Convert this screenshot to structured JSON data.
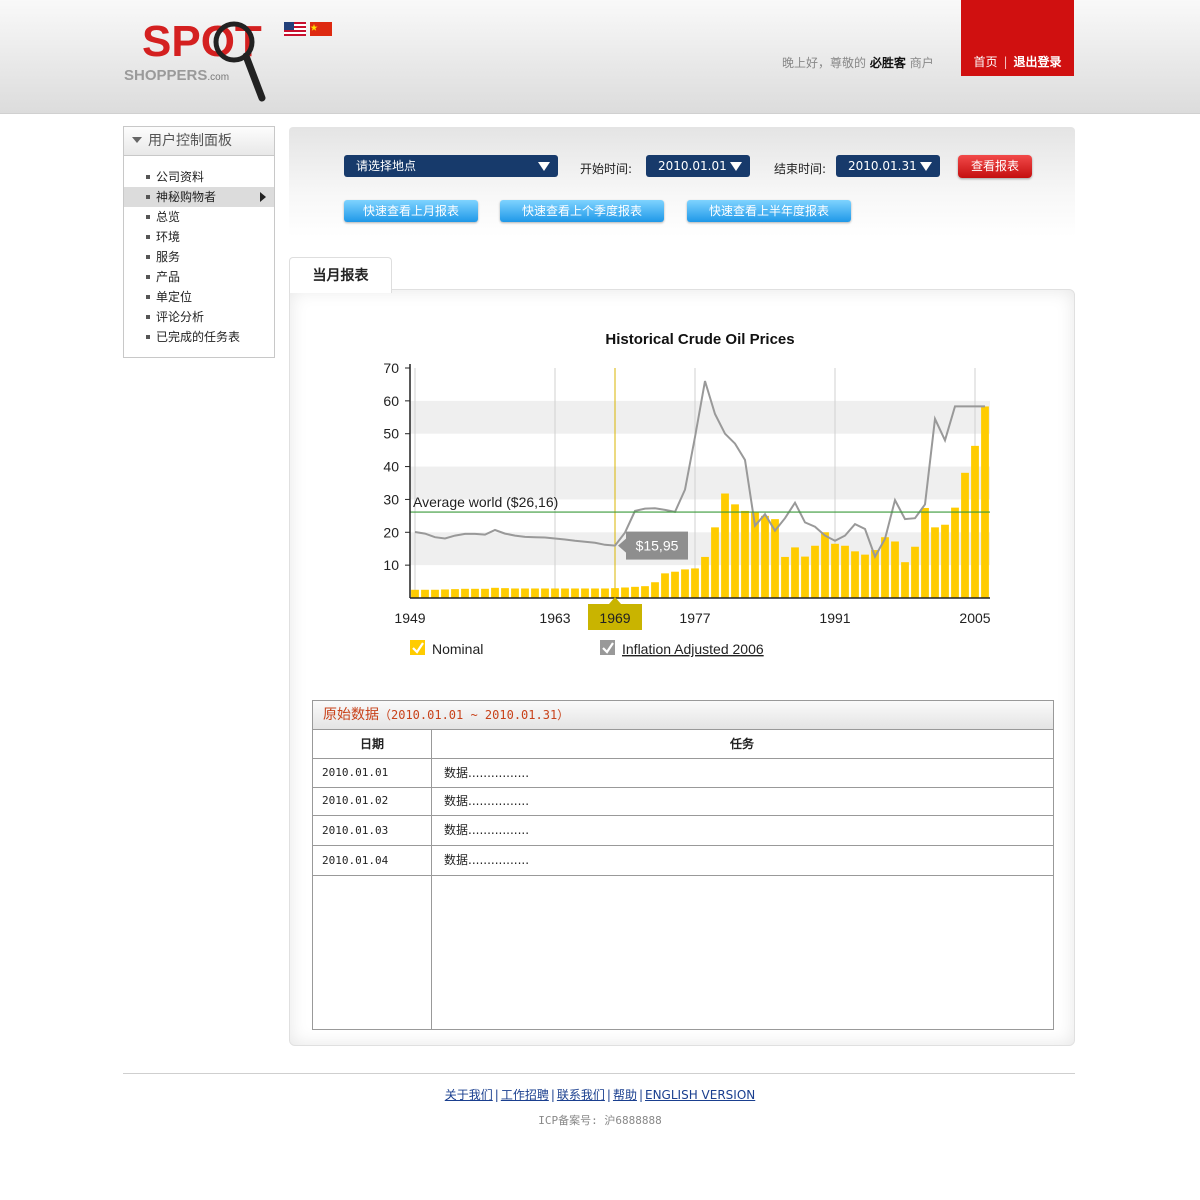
{
  "header": {
    "logo_text": "SPOT",
    "logo_subtext": "SHOPPERS",
    "logo_domain": ".com",
    "greeting_prefix": "晚上好，尊敬的",
    "greeting_name": "必胜客",
    "greeting_suffix": "商户",
    "nav_home": "首页",
    "nav_sep": "|",
    "nav_logout": "退出登录",
    "flags": [
      "us-flag-icon",
      "cn-flag-icon"
    ],
    "accent_color": "#d01010"
  },
  "sidebar": {
    "title": "用户控制面板",
    "items": [
      {
        "label": "公司资料"
      },
      {
        "label": "神秘购物者"
      },
      {
        "label": "总览"
      },
      {
        "label": "环境"
      },
      {
        "label": "服务"
      },
      {
        "label": "产品"
      },
      {
        "label": "单定位"
      },
      {
        "label": "评论分析"
      },
      {
        "label": "已完成的任务表"
      }
    ],
    "active_index": 1
  },
  "filter": {
    "location_placeholder": "请选择地点",
    "start_label": "开始时间:",
    "start_value": "2010.01.01",
    "end_label": "结束时间:",
    "end_value": "2010.01.31",
    "view_button": "查看报表",
    "quick_month": "快速查看上月报表",
    "quick_quarter": "快速查看上个季度报表",
    "quick_half": "快速查看上半年度报表"
  },
  "report": {
    "tab_label": "当月报表"
  },
  "chart_data": {
    "type": "bar",
    "title": "Historical Crude Oil Prices",
    "x_tick_labels": [
      "1949",
      "1963",
      "1969",
      "1977",
      "1991",
      "2005"
    ],
    "highlighted_x": "1969",
    "ylim": [
      0,
      70
    ],
    "y_ticks": [
      10,
      20,
      30,
      40,
      50,
      60,
      70
    ],
    "years": [
      1949,
      1950,
      1951,
      1952,
      1953,
      1954,
      1955,
      1956,
      1957,
      1958,
      1959,
      1960,
      1961,
      1962,
      1963,
      1964,
      1965,
      1966,
      1967,
      1968,
      1969,
      1970,
      1971,
      1972,
      1973,
      1974,
      1975,
      1976,
      1977,
      1978,
      1979,
      1980,
      1981,
      1982,
      1983,
      1984,
      1985,
      1986,
      1987,
      1988,
      1989,
      1990,
      1991,
      1992,
      1993,
      1994,
      1995,
      1996,
      1997,
      1998,
      1999,
      2000,
      2001,
      2002,
      2003,
      2004,
      2005,
      2006
    ],
    "series": [
      {
        "name": "Nominal",
        "type": "bar",
        "color": "#ffcc00",
        "checked": true,
        "values": [
          2.5,
          2.5,
          2.5,
          2.6,
          2.7,
          2.8,
          2.8,
          2.8,
          3.1,
          3.0,
          2.9,
          2.9,
          2.9,
          2.9,
          2.9,
          2.9,
          2.9,
          2.9,
          2.9,
          2.9,
          3.0,
          3.2,
          3.4,
          3.6,
          4.8,
          7.5,
          8.0,
          8.7,
          9.0,
          12.5,
          21.5,
          31.8,
          28.5,
          26.5,
          26.0,
          25.0,
          24.0,
          12.5,
          15.4,
          12.6,
          15.9,
          20.0,
          16.5,
          15.9,
          14.2,
          13.2,
          14.6,
          18.5,
          17.2,
          10.9,
          15.6,
          27.4,
          21.5,
          22.3,
          27.5,
          38.1,
          46.3,
          58.3
        ]
      },
      {
        "name": "Inflation Adjusted 2006",
        "type": "line",
        "color": "#999999",
        "checked": true,
        "values": [
          20.1,
          19.6,
          18.5,
          18.1,
          19.0,
          19.5,
          19.5,
          19.3,
          20.7,
          19.6,
          19.0,
          18.6,
          18.5,
          18.4,
          18.1,
          17.8,
          17.4,
          17.1,
          16.8,
          16.2,
          15.95,
          19.9,
          26.5,
          27.2,
          27.3,
          26.8,
          26.2,
          33.0,
          49.0,
          66.0,
          56.0,
          50.0,
          47.0,
          42.0,
          22.0,
          25.5,
          20.5,
          24.3,
          29.0,
          23.0,
          21.7,
          19.0,
          17.4,
          19.0,
          22.5,
          21.0,
          12.6,
          18.0,
          29.8,
          24.0,
          24.3,
          28.5,
          54.5,
          48.0,
          58.3,
          58.3,
          58.3,
          58.3
        ]
      }
    ],
    "average_line": {
      "label": "Average world ($26,16)",
      "value": 26.16,
      "color": "#3a9a3a"
    },
    "tooltip": {
      "label": "$15,95",
      "value": 15.95,
      "x": "1969"
    }
  },
  "table": {
    "title": "原始数据",
    "range": "（2010.01.01 ~ 2010.01.31）",
    "col_date": "日期",
    "col_task": "任务",
    "rows": [
      {
        "date": "2010.01.01",
        "task": "数据................"
      },
      {
        "date": "2010.01.02",
        "task": "数据................"
      },
      {
        "date": "2010.01.03",
        "task": "数据................"
      },
      {
        "date": "2010.01.04",
        "task": "数据................"
      }
    ]
  },
  "footer": {
    "links": [
      "关于我们",
      "工作招聘",
      "联系我们",
      "帮助",
      "ENGLISH VERSION"
    ],
    "sep": "|",
    "icp": "ICP备案号: 沪6888888"
  }
}
